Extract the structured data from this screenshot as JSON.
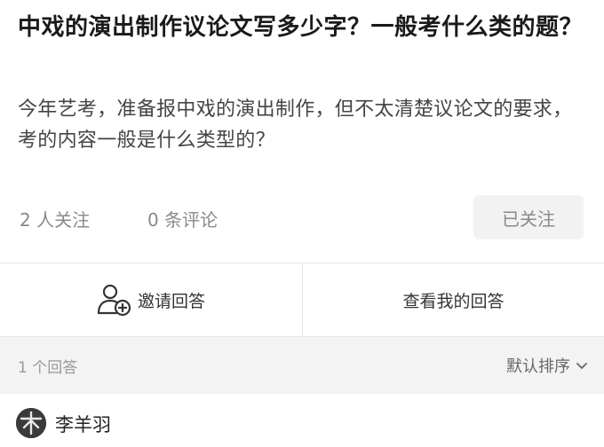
{
  "question": {
    "title": "中戏的演出制作议论文写多少字？一般考什么类的题？",
    "description": "今年艺考，准备报中戏的演出制作，但不太清楚议论文的要求，考的内容一般是什么类型的？"
  },
  "meta": {
    "followers": "2 人关注",
    "comments": "0 条评论",
    "follow_button": "已关注"
  },
  "actions": {
    "invite_label": "邀请回答",
    "invite_icon": "add-user-icon",
    "my_answer_label": "查看我的回答"
  },
  "answers_bar": {
    "count": "1 个回答",
    "sort_label": "默认排序",
    "sort_icon": "chevron-down-icon"
  },
  "answer": {
    "author": "李羊羽"
  },
  "colors": {
    "title": "#1a1a1a",
    "muted": "#8a8a8a",
    "sort_bar_bg": "#f3f3f3",
    "button_bg": "#f2f2f2"
  }
}
